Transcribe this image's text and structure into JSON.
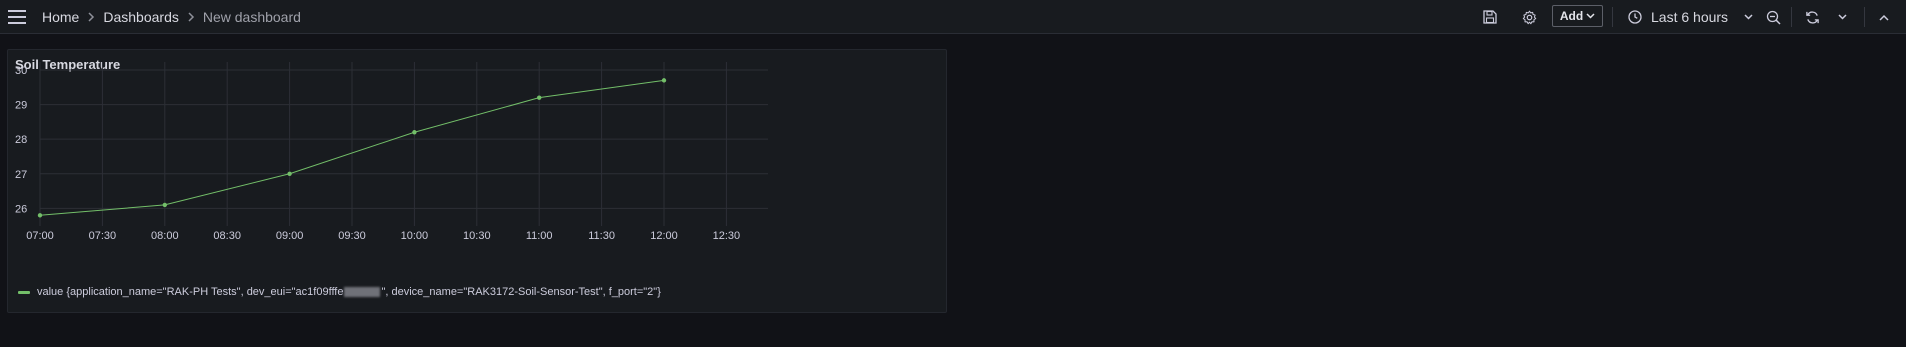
{
  "breadcrumb": {
    "items": [
      "Home",
      "Dashboards",
      "New dashboard"
    ]
  },
  "toolbar": {
    "add_label": "Add",
    "time_range": "Last 6 hours"
  },
  "panel": {
    "title": "Soil Temperature",
    "legend": {
      "prefix": "value {application_name=\"RAK-PH Tests\", dev_eui=\"ac1f09fffe",
      "suffix": "\", device_name=\"RAK3172-Soil-Sensor-Test\", f_port=\"2\"}"
    }
  },
  "colors": {
    "background": "#111217",
    "panel": "#181b1f",
    "series": "#73bf69",
    "grid": "#2c2f36"
  },
  "chart_data": {
    "type": "line",
    "title": "Soil Temperature",
    "x_ticks": [
      "07:00",
      "07:30",
      "08:00",
      "08:30",
      "09:00",
      "09:30",
      "10:00",
      "10:30",
      "11:00",
      "11:30",
      "12:00",
      "12:30"
    ],
    "y_ticks": [
      26,
      27,
      28,
      29,
      30
    ],
    "ylim": [
      25.75,
      30
    ],
    "xlim": [
      "07:00",
      "12:50"
    ],
    "grid": true,
    "legend_position": "bottom-left",
    "series": [
      {
        "x": [
          "07:00",
          "08:00",
          "09:00",
          "10:00",
          "11:00",
          "12:00"
        ],
        "values": [
          25.8,
          26.1,
          27.0,
          28.2,
          29.2,
          29.7
        ]
      }
    ]
  }
}
